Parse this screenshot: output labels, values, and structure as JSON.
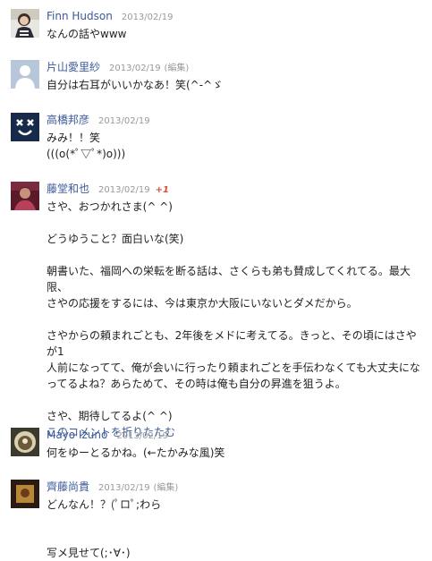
{
  "comments": [
    {
      "author": "Finn Hudson",
      "time": "2013/02/19",
      "avatar_icon": "user-photo-icon",
      "lines": [
        "なんの話やwww"
      ]
    },
    {
      "author": "片山愛里紗",
      "time": "2013/02/19",
      "edited": "(編集)",
      "avatar_icon": "default-avatar-icon",
      "lines": [
        "自分は右耳がいいかなあ！笑(^-^ゞ"
      ]
    },
    {
      "author": "高橋邦彦",
      "time": "2013/02/19",
      "avatar_icon": "face-avatar-icon",
      "lines": [
        "みみ！！笑",
        "(((o(*ﾟ▽ﾟ*)o)))"
      ]
    },
    {
      "author": "藤堂和也",
      "time": "2013/02/19",
      "plus_one": "+1",
      "avatar_icon": "user-photo-icon",
      "paragraphs": [
        [
          "さや、おつかれさま(^ ^)"
        ],
        [
          "どうゆうこと？面白いな(笑)"
        ],
        [
          "朝書いた、福岡への栄転を断る話は、さくらも弟も賛成してくれてる。最大限、",
          "さやの応援をするには、今は東京か大阪にいないとダメだから。"
        ],
        [
          "さやからの頼まれごとも、2年後をメドに考えてる。きっと、その頃にはさやが1",
          "人前になってて、俺が会いに行ったり頼まれごとを手伝わなくても大丈夫にな",
          "ってるよね？あらためて、その時は俺も自分の昇進を狙うよ。"
        ],
        [
          "さや、期待してるよ(^ ^)"
        ]
      ],
      "collapse_link": "このコメントを折りたたむ"
    },
    {
      "author": "Mayo Izuno",
      "time": "2013/02/19",
      "avatar_icon": "user-photo-icon",
      "lines": [
        "何をゆーとるかね。(←たかみな風)笑"
      ]
    },
    {
      "author": "齊藤尚貴",
      "time": "2013/02/19",
      "edited": "(編集)",
      "avatar_icon": "user-photo-icon",
      "paragraphs": [
        [
          "どんなん！？(ﾟロﾟ;わら"
        ],
        [],
        [
          "写メ見せて(;･∀･)"
        ]
      ]
    }
  ]
}
